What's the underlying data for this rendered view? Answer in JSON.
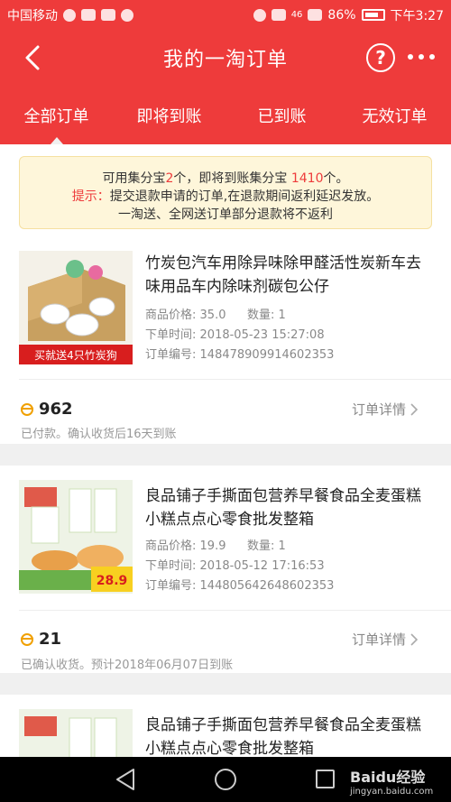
{
  "status_bar": {
    "carrier": "中国移动",
    "signal_label": "46",
    "battery": "86%",
    "time": "下午3:27",
    "icons": [
      "weather-icon",
      "app-icon",
      "taobao-icon",
      "alarm-icon",
      "hd-icon",
      "wifi-icon",
      "signal-icon",
      "battery-icon"
    ]
  },
  "header": {
    "title": "我的一淘订单",
    "back_icon": "chevron-left-icon",
    "help_label": "?",
    "more_icon": "more-dots-icon"
  },
  "tabs": [
    {
      "label": "全部订单",
      "active": true
    },
    {
      "label": "即将到账",
      "active": false
    },
    {
      "label": "已到账",
      "active": false
    },
    {
      "label": "无效订单",
      "active": false
    }
  ],
  "notice": {
    "line1_a": "可用集分宝",
    "line1_available": "2",
    "line1_b": "个，即将到账集分宝 ",
    "line1_pending": "1410",
    "line1_c": "个。",
    "line2_prefix": "提示：",
    "line2_text": "提交退款申请的订单,在退款期间返利延迟发放。",
    "line3": "一淘送、全网送订单部分退款将不返利"
  },
  "labels": {
    "price": "商品价格:",
    "qty": "数量:",
    "order_time": "下单时间:",
    "order_no": "订单编号:",
    "detail": "订单详情"
  },
  "orders": [
    {
      "name": "竹炭包汽车用除异味除甲醛活性炭新车去味用品车内除味剂碳包公仔",
      "price": "35.0",
      "qty": "1",
      "time": "2018-05-23 15:27:08",
      "order_no": "148478909914602353",
      "coins": "962",
      "status": "已付款。确认收货后16天到账",
      "thumb_banner": "买就送4只竹炭狗"
    },
    {
      "name": "良品铺子手撕面包营养早餐食品全麦蛋糕小糕点点心零食批发整箱",
      "price": "19.9",
      "qty": "1",
      "time": "2018-05-12 17:16:53",
      "order_no": "144805642648602353",
      "coins": "21",
      "status": "已确认收货。预计2018年06月07日到账",
      "thumb_price": "28.9"
    },
    {
      "name": "良品铺子手撕面包营养早餐食品全麦蛋糕小糕点点心零食批发整箱"
    }
  ],
  "navbar": {
    "icons": [
      "nav-back-icon",
      "nav-home-icon",
      "nav-recent-icon"
    ]
  },
  "watermark": {
    "brand": "Baidu经验",
    "url": "jingyan.baidu.com"
  },
  "colors": {
    "accent": "#ee3b3b",
    "notice_bg": "#fef6da",
    "coin": "#f0a000"
  }
}
